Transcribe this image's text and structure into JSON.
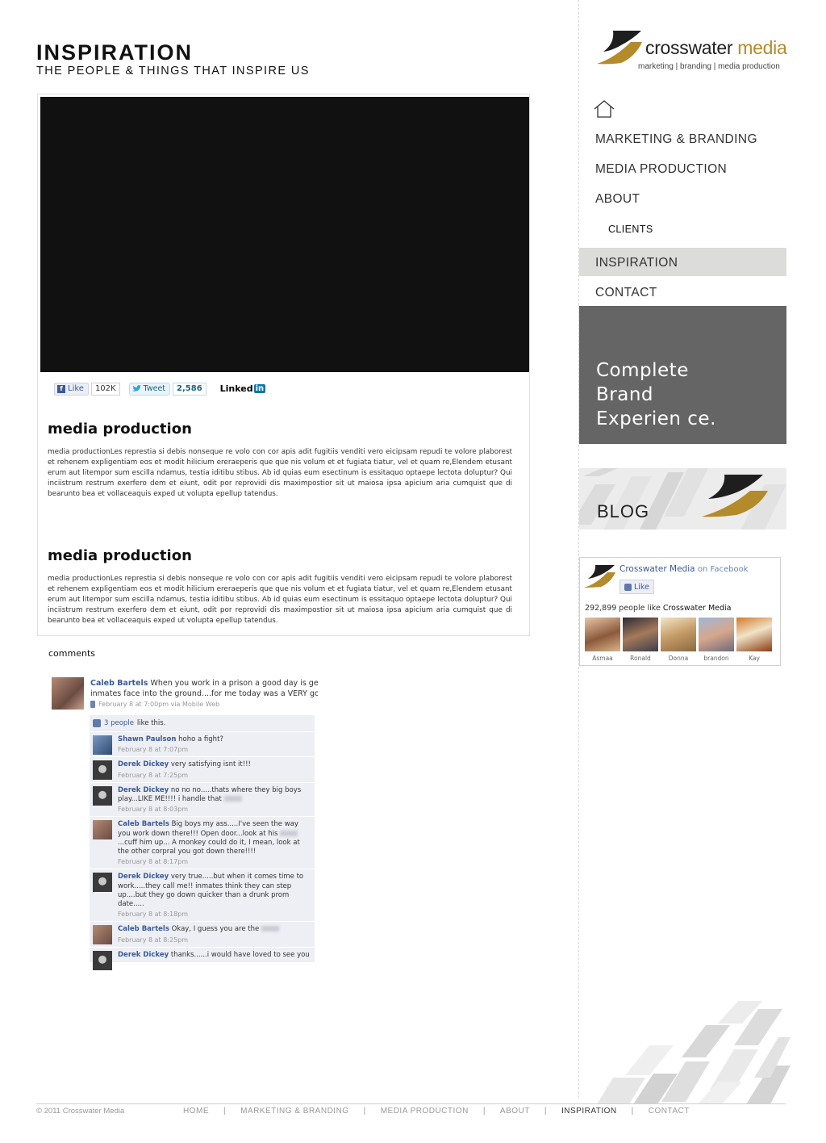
{
  "header": {
    "title": "INSPIRATION",
    "subtitle": "THE PEOPLE & THINGS THAT INSPIRE US"
  },
  "share": {
    "like_label": "Like",
    "like_count": "102K",
    "tweet_label": "Tweet",
    "tweet_count": "2,586",
    "linkedin_label": "Linked",
    "linkedin_in": "in"
  },
  "sections": [
    {
      "title": "media production",
      "body": "media productionLes represtia si debis nonseque re volo con cor apis adit fugitiis venditi vero eicipsam repudi te volore plaborest et rehenem expligentiam eos et modit hilicium ereraeperis que que nis volum et et fugiata tiatur, vel et quam re,Elendem etusant erum aut litempor sum escilla ndamus, testia iditibu stibus. Ab id quias eum esectinum is essitaquo optaepe lectota doluptur? Qui inciistrum restrum exerfero dem et eiunt, odit por reprovidi dis maximpostior sit ut maiosa ipsa apicium aria cumquist que di bearunto bea et vollaceaquis exped ut volupta epellup tatendus."
    },
    {
      "title": "media production",
      "body": "media productionLes represtia si debis nonseque re volo con cor apis adit fugitiis venditi vero eicipsam repudi te volore plaborest et rehenem expligentiam eos et modit hilicium ereraeperis que que nis volum et et fugiata tiatur, vel et quam re,Elendem etusant erum aut litempor sum escilla ndamus, testia iditibu stibus. Ab id quias eum esectinum is essitaquo optaepe lectota doluptur? Qui inciistrum restrum exerfero dem et eiunt, odit por reprovidi dis maximpostior sit ut maiosa ipsa apicium aria cumquist que di bearunto bea et vollaceaquis exped ut volupta epellup tatendus."
    }
  ],
  "comments_label": "comments",
  "post": {
    "author": "Caleb Bartels",
    "text": "When you work in a prison a good day is getting to smash an inmates face into the ground....for me today was a VERY good day",
    "time": "February 8 at 7:00pm via Mobile Web",
    "likes_link": "3 people",
    "likes_rest": "like this.",
    "comments": [
      {
        "author": "Shawn Paulson",
        "text": "hoho a fight?",
        "time": "February 8 at 7:07pm",
        "avatar": "shawn"
      },
      {
        "author": "Derek Dickey",
        "text": "very satisfying isnt it!!!",
        "time": "February 8 at 7:25pm",
        "avatar": "derek"
      },
      {
        "author": "Derek Dickey",
        "text": "no no no.....thats where they big boys play...LIKE ME!!!! i handle that",
        "time": "February 8 at 8:03pm",
        "avatar": "derek"
      },
      {
        "author": "Caleb Bartels",
        "text": "Big boys my ass.....I've seen the way you work down there!!! Open door...look at his",
        "text2": "...cuff him up... A monkey could do it, I mean, look at the other corpral you got down there!!!!",
        "time": "February 8 at 8:17pm",
        "avatar": "caleb"
      },
      {
        "author": "Derek Dickey",
        "text": "very true.....but when it comes time to work.....they call me!! inmates think they can step up....but they go down quicker than a drunk prom date.....",
        "time": "February 8 at 8:18pm",
        "avatar": "derek"
      },
      {
        "author": "Caleb Bartels",
        "text": "Okay, I guess you are the",
        "time": "February 8 at 8:25pm",
        "avatar": "caleb"
      },
      {
        "author": "Derek Dickey",
        "text": "thanks......i would have loved to see you",
        "time": "",
        "avatar": "derek"
      }
    ]
  },
  "logo": {
    "word1": "crosswater",
    "word2": "media",
    "tagline": "marketing | branding | media production",
    "gold": "#b38b2a",
    "dark": "#1e1e1e"
  },
  "nav": {
    "home_icon": "home-icon",
    "items": [
      "MARKETING & BRANDING",
      "MEDIA PRODUCTION",
      "ABOUT"
    ],
    "sub": "CLIENTS",
    "active": "INSPIRATION",
    "contact": "CONTACT"
  },
  "brand_box": {
    "text": "Complete\nBrand\nExperien ce."
  },
  "blog_label": "BLOG",
  "facebook": {
    "page_name": "Crosswater Media",
    "on": "on Facebook",
    "like": "Like",
    "count": "292,899 people like",
    "count_page": "Crosswater Media",
    "fans": [
      "Asmaa",
      "Ronald",
      "Donna",
      "brandon",
      "Kay"
    ]
  },
  "footer": {
    "copyright": "© 2011 Crosswater Media",
    "links": [
      "HOME",
      "MARKETING & BRANDING",
      "MEDIA PRODUCTION",
      "ABOUT",
      "INSPIRATION",
      "CONTACT"
    ],
    "current": "INSPIRATION"
  }
}
